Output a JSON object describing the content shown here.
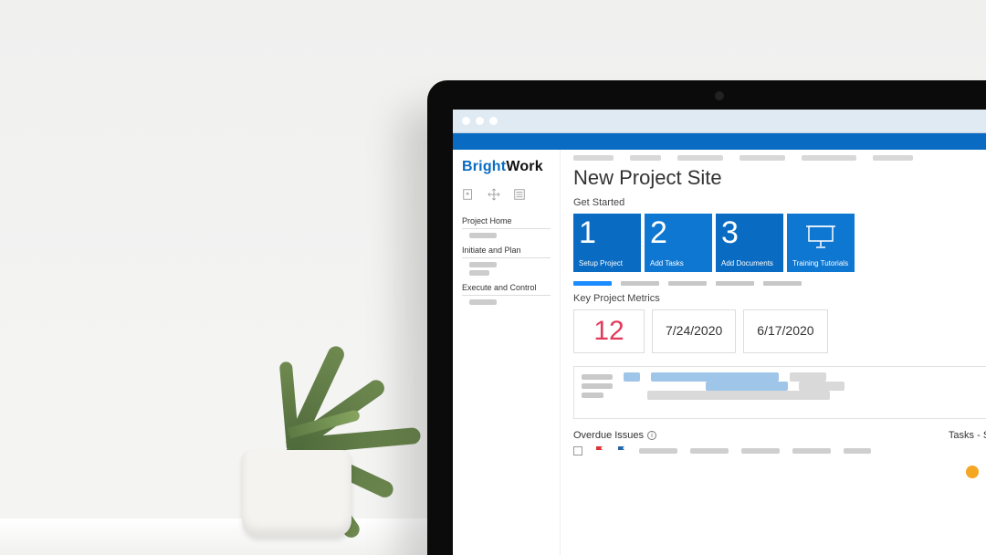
{
  "brand": {
    "part1": "Bright",
    "part2": "Work"
  },
  "sidebar": {
    "sections": [
      {
        "label": "Project Home"
      },
      {
        "label": "Initiate and Plan"
      },
      {
        "label": "Execute and Control"
      }
    ]
  },
  "page": {
    "title": "New Project Site",
    "get_started_label": "Get Started",
    "metrics_label": "Key Project Metrics",
    "overdue_label": "Overdue Issues",
    "tasks_label": "Tasks - Status"
  },
  "tiles": [
    {
      "num": "1",
      "caption": "Setup Project"
    },
    {
      "num": "2",
      "caption": "Add Tasks"
    },
    {
      "num": "3",
      "caption": "Add Documents"
    },
    {
      "num": "",
      "caption": "Training Tutorials"
    }
  ],
  "metrics": [
    {
      "value": "12",
      "style": "big"
    },
    {
      "value": "7/24/2020",
      "style": "date"
    },
    {
      "value": "6/17/2020",
      "style": "date"
    }
  ],
  "colors": {
    "brand_blue": "#0a6bc2",
    "accent_red": "#e23b5a",
    "warn": "#f5a623",
    "error": "#e04646"
  }
}
